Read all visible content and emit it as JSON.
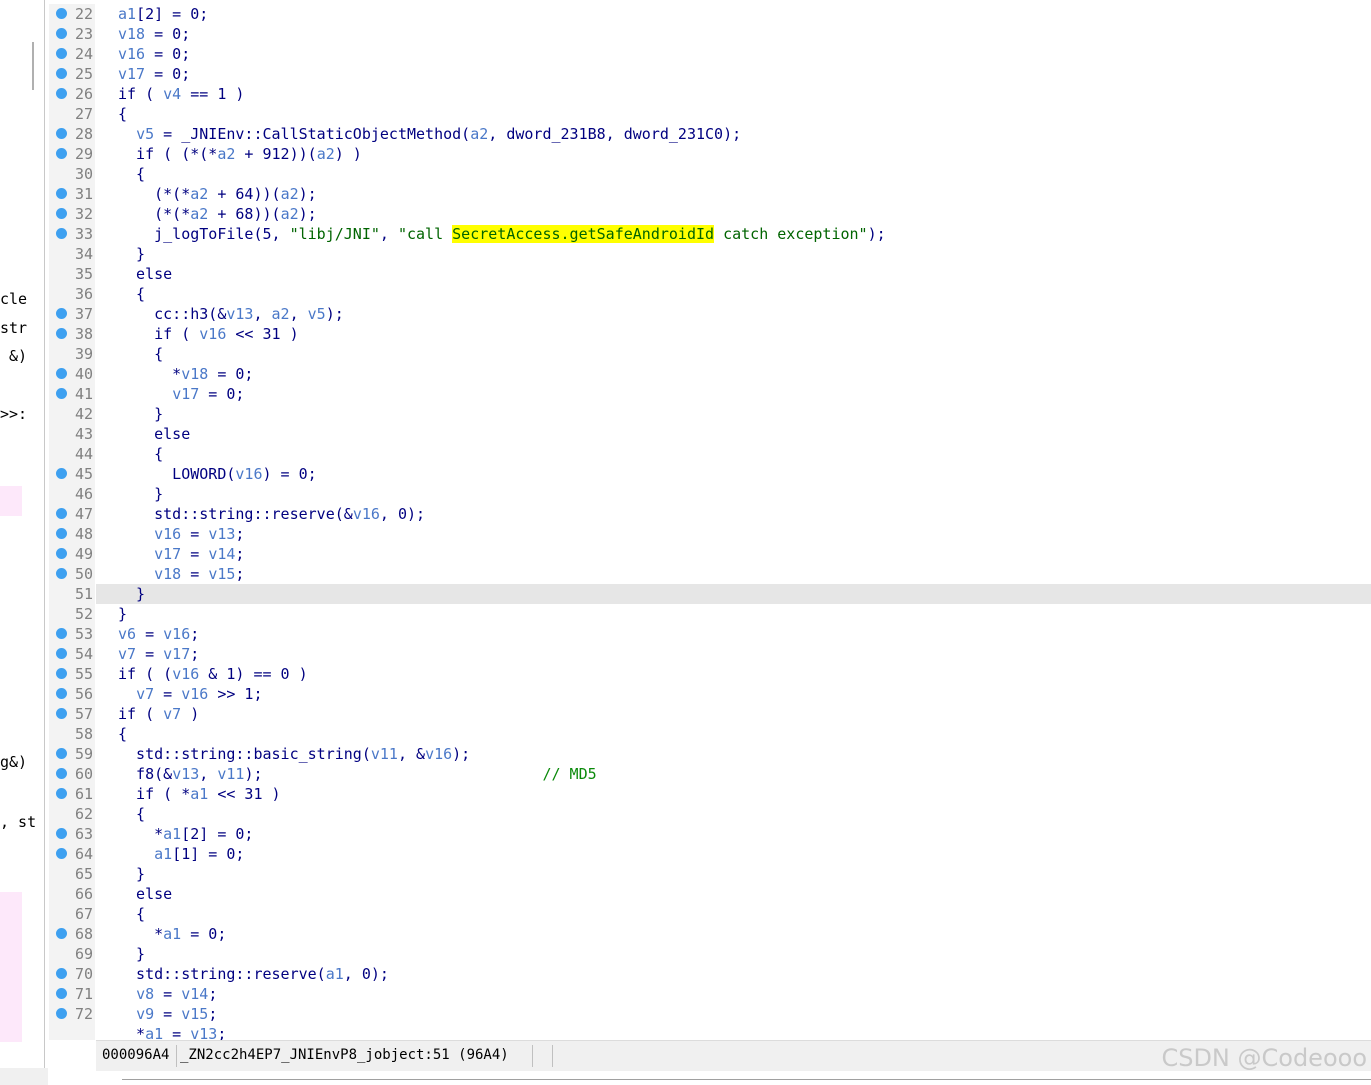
{
  "left_panel": {
    "fragments": [
      {
        "text": "cle",
        "top": 0
      },
      {
        "text": "str",
        "top": 0
      },
      {
        "text": " &)",
        "top": 0
      },
      {
        "text": ">>:",
        "top": 0
      },
      {
        "text": "g&)",
        "top": 0
      },
      {
        "text": ", st",
        "top": 0
      }
    ]
  },
  "code": {
    "highlight_line": "51",
    "lines": [
      {
        "num": "22",
        "bp": true,
        "html": "a1[2] = 0;"
      },
      {
        "num": "23",
        "bp": true,
        "html": "v18 = 0;"
      },
      {
        "num": "24",
        "bp": true,
        "html": "v16 = 0;"
      },
      {
        "num": "25",
        "bp": true,
        "html": "v17 = 0;"
      },
      {
        "num": "26",
        "bp": true,
        "html": "if ( v4 == 1 )"
      },
      {
        "num": "27",
        "bp": false,
        "html": "{"
      },
      {
        "num": "28",
        "bp": true,
        "html": "  v5 = _JNIEnv::CallStaticObjectMethod(a2, dword_231B8, dword_231C0);"
      },
      {
        "num": "29",
        "bp": true,
        "html": "  if ( (*(*a2 + 912))(a2) )"
      },
      {
        "num": "30",
        "bp": false,
        "html": "  {"
      },
      {
        "num": "31",
        "bp": true,
        "html": "    (*(*a2 + 64))(a2);"
      },
      {
        "num": "32",
        "bp": true,
        "html": "    (*(*a2 + 68))(a2);"
      },
      {
        "num": "33",
        "bp": true,
        "html": "    j_logToFile(5, \"libj/JNI\", \"call SecretAccess.getSafeAndroidId catch exception\");"
      },
      {
        "num": "34",
        "bp": false,
        "html": "  }"
      },
      {
        "num": "35",
        "bp": false,
        "html": "  else"
      },
      {
        "num": "36",
        "bp": false,
        "html": "  {"
      },
      {
        "num": "37",
        "bp": true,
        "html": "    cc::h3(&v13, a2, v5);"
      },
      {
        "num": "38",
        "bp": true,
        "html": "    if ( v16 << 31 )"
      },
      {
        "num": "39",
        "bp": false,
        "html": "    {"
      },
      {
        "num": "40",
        "bp": true,
        "html": "      *v18 = 0;"
      },
      {
        "num": "41",
        "bp": true,
        "html": "      v17 = 0;"
      },
      {
        "num": "42",
        "bp": false,
        "html": "    }"
      },
      {
        "num": "43",
        "bp": false,
        "html": "    else"
      },
      {
        "num": "44",
        "bp": false,
        "html": "    {"
      },
      {
        "num": "45",
        "bp": true,
        "html": "      LOWORD(v16) = 0;"
      },
      {
        "num": "46",
        "bp": false,
        "html": "    }"
      },
      {
        "num": "47",
        "bp": true,
        "html": "    std::string::reserve(&v16, 0);"
      },
      {
        "num": "48",
        "bp": true,
        "html": "    v16 = v13;"
      },
      {
        "num": "49",
        "bp": true,
        "html": "    v17 = v14;"
      },
      {
        "num": "50",
        "bp": true,
        "html": "    v18 = v15;"
      },
      {
        "num": "51",
        "bp": false,
        "html": "  }"
      },
      {
        "num": "52",
        "bp": false,
        "html": "}"
      },
      {
        "num": "53",
        "bp": true,
        "html": "v6 = v16;"
      },
      {
        "num": "54",
        "bp": true,
        "html": "v7 = v17;"
      },
      {
        "num": "55",
        "bp": true,
        "html": "if ( (v16 & 1) == 0 )"
      },
      {
        "num": "56",
        "bp": true,
        "html": "  v7 = v16 >> 1;"
      },
      {
        "num": "57",
        "bp": true,
        "html": "if ( v7 )"
      },
      {
        "num": "58",
        "bp": false,
        "html": "{"
      },
      {
        "num": "59",
        "bp": true,
        "html": "  std::string::basic_string(v11, &v16);"
      },
      {
        "num": "60",
        "bp": true,
        "html": "  f8(&v13, v11);                               // MD5"
      },
      {
        "num": "61",
        "bp": true,
        "html": "  if ( *a1 << 31 )"
      },
      {
        "num": "62",
        "bp": false,
        "html": "  {"
      },
      {
        "num": "63",
        "bp": true,
        "html": "    *a1[2] = 0;"
      },
      {
        "num": "64",
        "bp": true,
        "html": "    a1[1] = 0;"
      },
      {
        "num": "65",
        "bp": false,
        "html": "  }"
      },
      {
        "num": "66",
        "bp": false,
        "html": "  else"
      },
      {
        "num": "67",
        "bp": false,
        "html": "  {"
      },
      {
        "num": "68",
        "bp": true,
        "html": "    *a1 = 0;"
      },
      {
        "num": "69",
        "bp": false,
        "html": "  }"
      },
      {
        "num": "70",
        "bp": true,
        "html": "  std::string::reserve(a1, 0);"
      },
      {
        "num": "71",
        "bp": true,
        "html": "  v8 = v14;"
      },
      {
        "num": "72",
        "bp": true,
        "html": "  v9 = v15;"
      },
      {
        "num": "",
        "bp": false,
        "html": "  *a1 = v13;"
      }
    ]
  },
  "status": {
    "address": "000096A4",
    "location": "_ZN2cc2h4EP7_JNIEnvP8_jobject:51 (96A4)"
  },
  "watermark": "CSDN @Codeooo",
  "colors": {
    "keyword": "#000080",
    "variable": "#4a78c8",
    "string": "#006400",
    "comment": "#0a8a0a",
    "search_highlight": "#ffff00",
    "breakpoint_dot": "#3ea0f0",
    "current_line": "#e6e6e6"
  }
}
